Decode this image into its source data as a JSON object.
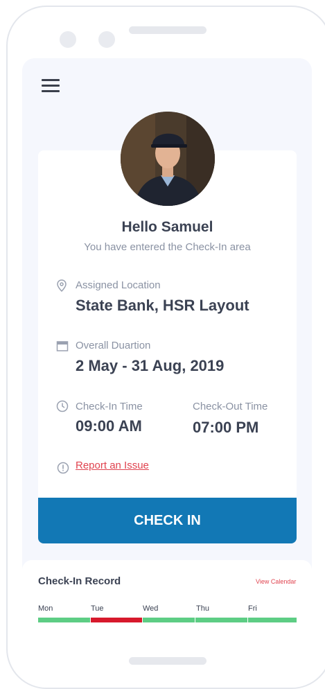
{
  "menu": {
    "icon": "hamburger-menu-icon"
  },
  "greeting": {
    "title": "Hello Samuel",
    "subtitle": "You have entered the Check-In area"
  },
  "assigned_location": {
    "label": "Assigned Location",
    "value": "State Bank, HSR Layout",
    "icon": "location-pin-icon"
  },
  "duration": {
    "label": "Overall Duartion",
    "value": "2 May - 31 Aug, 2019",
    "icon": "calendar-icon"
  },
  "check_in_time": {
    "label": "Check-In Time",
    "value": "09:00 AM",
    "icon": "clock-icon"
  },
  "check_out_time": {
    "label": "Check-Out Time",
    "value": "07:00 PM"
  },
  "report": {
    "label": "Report an Issue",
    "icon": "alert-circle-icon"
  },
  "check_in_button": {
    "label": "CHECK IN"
  },
  "record": {
    "title": "Check-In Record",
    "view_calendar": "View Calendar",
    "days": [
      {
        "label": "Mon",
        "status": "present"
      },
      {
        "label": "Tue",
        "status": "absent"
      },
      {
        "label": "Wed",
        "status": "present"
      },
      {
        "label": "Thu",
        "status": "present"
      },
      {
        "label": "Fri",
        "status": "present"
      }
    ]
  },
  "colors": {
    "primary": "#1278b5",
    "present": "#5dcd84",
    "absent": "#d7192c",
    "link": "#e0434f"
  }
}
